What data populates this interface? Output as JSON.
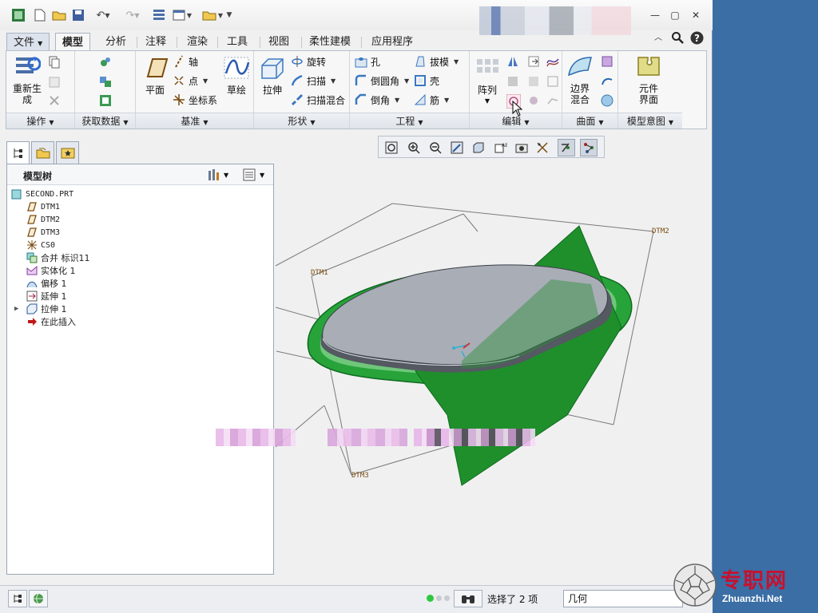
{
  "colors": {
    "accent": "#2f8f3a",
    "surface_green": "#1e9a2e",
    "part_gray": "#a6aab2",
    "desktop": "#3a6ea5"
  },
  "ribbon_tabs": [
    "文件",
    "模型",
    "分析",
    "注释",
    "渲染",
    "工具",
    "视图",
    "柔性建模",
    "应用程序"
  ],
  "active_tab": "模型",
  "groups": {
    "operations": {
      "label": "操作",
      "regen": "重新生\n成"
    },
    "get_data": {
      "label": "获取数据"
    },
    "datum": {
      "label": "基准",
      "plane": "平面",
      "axis": "轴",
      "point": "点",
      "csys": "坐标系",
      "sketch": "草绘"
    },
    "shapes": {
      "label": "形状",
      "extrude": "拉伸",
      "revolve": "旋转",
      "sweep": "扫描",
      "swept_blend": "扫描混合"
    },
    "engineering": {
      "label": "工程",
      "hole": "孔",
      "round": "倒圆角",
      "chamfer": "倒角",
      "draft": "拔模",
      "shell": "壳",
      "rib": "筋"
    },
    "editing": {
      "label": "编辑",
      "pattern": "阵列"
    },
    "surfaces": {
      "label": "曲面",
      "boundary_blend": "边界\n混合"
    },
    "model_intent": {
      "label": "模型意图",
      "component_interface": "元件\n界面"
    }
  },
  "model_tree": {
    "title": "模型树",
    "items": [
      {
        "label": "SECOND.PRT",
        "icon": "part-icon"
      },
      {
        "label": "DTM1",
        "icon": "datum-plane-icon"
      },
      {
        "label": "DTM2",
        "icon": "datum-plane-icon"
      },
      {
        "label": "DTM3",
        "icon": "datum-plane-icon"
      },
      {
        "label": "CS0",
        "icon": "csys-icon"
      },
      {
        "label": "合并 标识11",
        "icon": "merge-icon"
      },
      {
        "label": "实体化 1",
        "icon": "solidify-icon"
      },
      {
        "label": "偏移 1",
        "icon": "offset-icon"
      },
      {
        "label": "延伸 1",
        "icon": "extend-icon"
      },
      {
        "label": "拉伸 1",
        "icon": "extrude-icon"
      },
      {
        "label": "在此插入",
        "icon": "insert-here-icon"
      }
    ]
  },
  "viewport": {
    "datum_labels": [
      "DTM1",
      "DTM2",
      "DTM3"
    ]
  },
  "status": {
    "selection": "选择了 2 项",
    "filter_value": "几何"
  },
  "watermark": {
    "cn": "专职网",
    "en": "Zhuanzhi.Net"
  }
}
